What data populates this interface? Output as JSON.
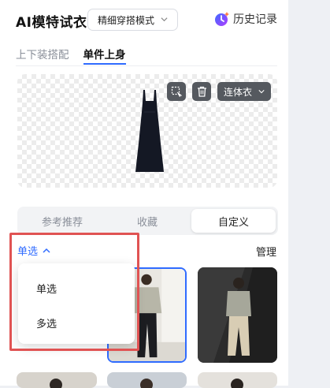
{
  "header": {
    "app_title": "AI模特试衣",
    "mode_select": "精细穿搭模式",
    "history_label": "历史记录"
  },
  "tabs": [
    {
      "label": "上下装搭配",
      "active": false
    },
    {
      "label": "单件上身",
      "active": true
    }
  ],
  "preview": {
    "category_select": "连体衣"
  },
  "segment": [
    {
      "label": "参考推荐",
      "active": false
    },
    {
      "label": "收藏",
      "active": false
    },
    {
      "label": "自定义",
      "active": true
    }
  ],
  "toolbar": {
    "select_mode": "单选",
    "manage_label": "管理"
  },
  "dropdown": {
    "options": [
      "单选",
      "多选"
    ]
  },
  "colors": {
    "accent": "#2f6bff",
    "annotation_red": "#e05353"
  }
}
